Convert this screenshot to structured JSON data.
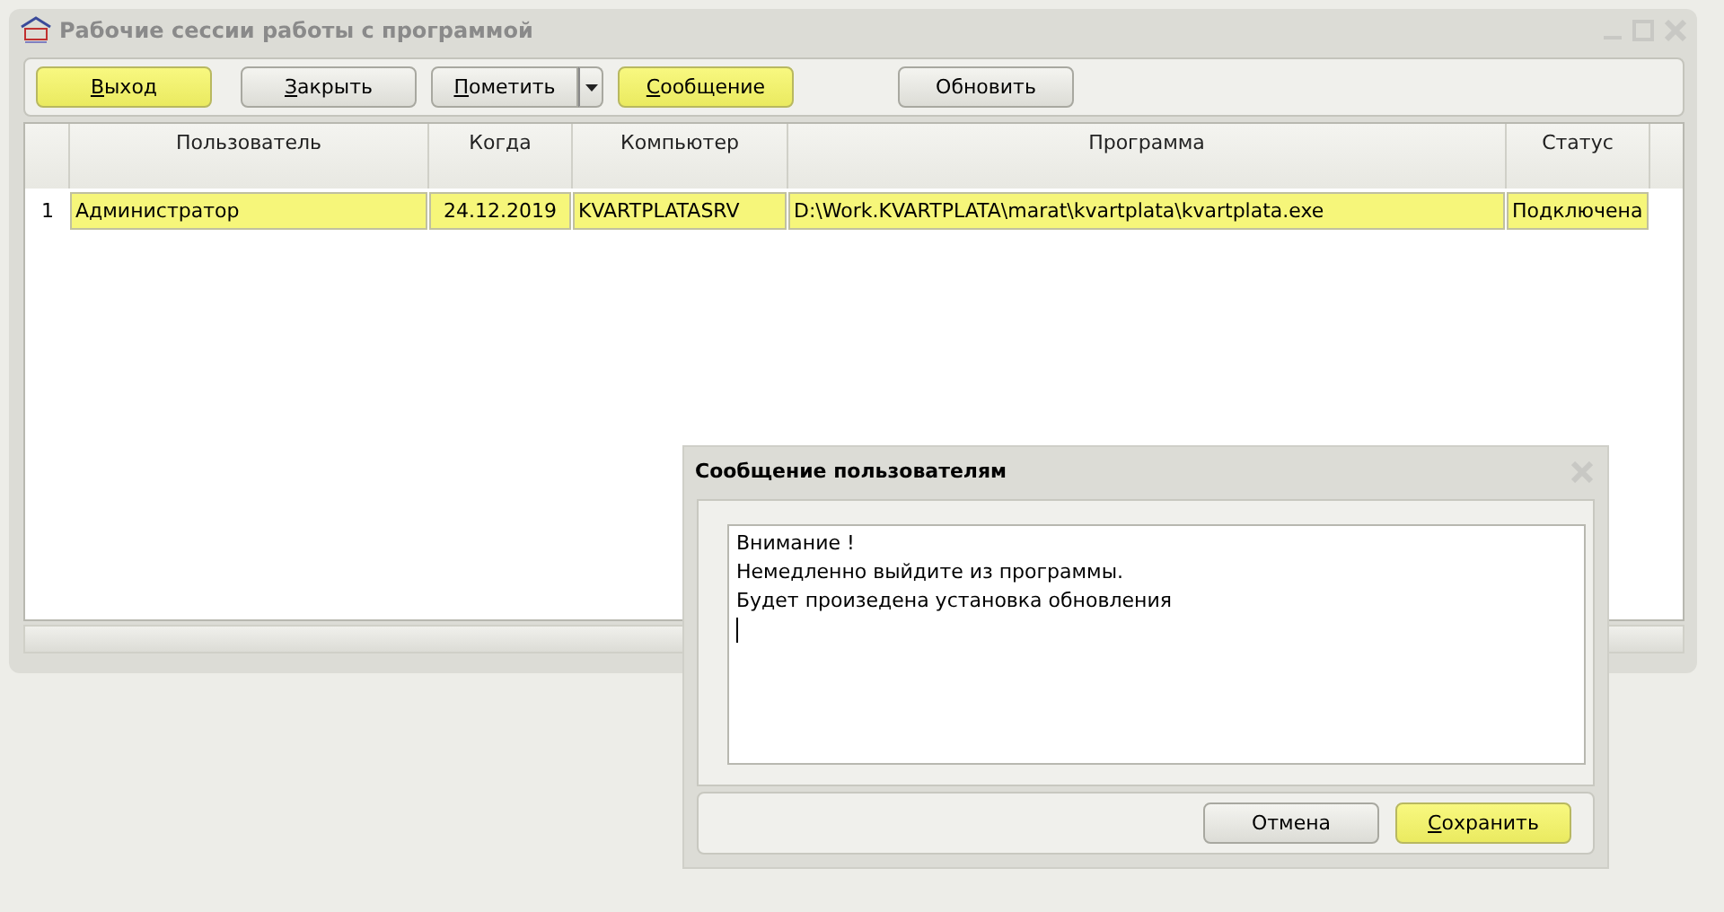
{
  "window": {
    "title": "Рабочие сессии работы с программой"
  },
  "toolbar": [
    {
      "label": "Выход",
      "highlighted": true,
      "mnemonic": true,
      "kind": "button"
    },
    {
      "label": "Закрыть",
      "highlighted": false,
      "mnemonic": true,
      "kind": "button"
    },
    {
      "label": "Пометить",
      "highlighted": false,
      "mnemonic": true,
      "kind": "split"
    },
    {
      "label": "Сообщение",
      "highlighted": true,
      "mnemonic": true,
      "kind": "button"
    },
    {
      "label": "Обновить",
      "highlighted": false,
      "mnemonic": false,
      "kind": "button"
    }
  ],
  "table": {
    "columns": [
      "Пользователь",
      "Когда",
      "Компьютер",
      "Программа",
      "Статус"
    ],
    "rows": [
      {
        "number": "1",
        "selected": true,
        "cells": [
          "Администратор",
          "24.12.2019",
          "KVARTPLATASRV",
          "D:\\Work.KVARTPLATA\\marat\\kvartplata\\kvartplata.exe",
          "Подключена"
        ]
      }
    ]
  },
  "dialog": {
    "title": "Сообщение пользователям",
    "message": [
      "Внимание !",
      "Немедленно выйдите из программы.",
      "Будет произедена установка обновления"
    ],
    "buttons": [
      {
        "label": "Отмена",
        "highlighted": false,
        "mnemonic": false
      },
      {
        "label": "Сохранить",
        "highlighted": true,
        "mnemonic": true
      }
    ]
  }
}
